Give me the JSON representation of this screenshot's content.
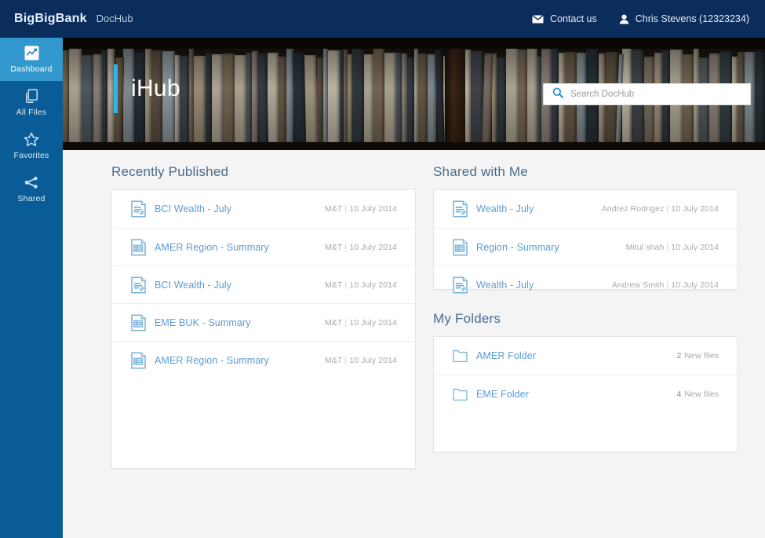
{
  "topbar": {
    "brand": "BigBigBank",
    "brand_sub": "DocHub",
    "contact_label": "Contact us",
    "contact_icon": "envelope-icon",
    "user_label": "Chris Stevens (12323234)",
    "user_icon": "person-icon",
    "background_color": "#0b2d5c"
  },
  "sidebar": {
    "background_color": "#0a5c96",
    "active_color": "#3398ce",
    "items": [
      {
        "label": "Dashboard",
        "icon": "chart-icon",
        "active": true
      },
      {
        "label": "All Files",
        "icon": "copy-files-icon",
        "active": false
      },
      {
        "label": "Favorites",
        "icon": "star-icon",
        "active": false
      },
      {
        "label": "Shared",
        "icon": "share-icon",
        "active": false
      }
    ]
  },
  "hero": {
    "title": "iHub",
    "accent_color": "#29b6e8",
    "background_image": "bookshelf-photo"
  },
  "search": {
    "placeholder": "Search DocHub",
    "value": "",
    "icon": "search-icon"
  },
  "sections": {
    "recently_published": {
      "title": "Recently Published",
      "items": [
        {
          "name": "BCI Wealth - July",
          "icon": "document-icon",
          "source": "M&T",
          "date": "10 July 2014"
        },
        {
          "name": "AMER Region - Summary",
          "icon": "report-icon",
          "source": "M&T",
          "date": "10 July 2014"
        },
        {
          "name": "BCI Wealth - July",
          "icon": "document-icon",
          "source": "M&T",
          "date": "10 July 2014"
        },
        {
          "name": "EME BUK - Summary",
          "icon": "report-icon",
          "source": "M&T",
          "date": "10 July 2014"
        },
        {
          "name": "AMER Region - Summary",
          "icon": "report-icon",
          "source": "M&T",
          "date": "10 July 2014"
        }
      ]
    },
    "shared_with_me": {
      "title": "Shared with Me",
      "items": [
        {
          "name": "Wealth - July",
          "icon": "document-icon",
          "source": "Andrez Rodrigez",
          "date": "10 July 2014"
        },
        {
          "name": "Region - Summary",
          "icon": "report-icon",
          "source": "Mitul shah",
          "date": "10 July 2014"
        },
        {
          "name": "Wealth - July",
          "icon": "document-icon",
          "source": "Andrew Smith",
          "date": "10 July 2014"
        }
      ]
    },
    "my_folders": {
      "title": "My Folders",
      "items": [
        {
          "name": "AMER Folder",
          "icon": "folder-icon",
          "count": "2",
          "count_label": "New files"
        },
        {
          "name": "EME Folder",
          "icon": "folder-icon",
          "count": "4",
          "count_label": "New files"
        }
      ]
    }
  }
}
